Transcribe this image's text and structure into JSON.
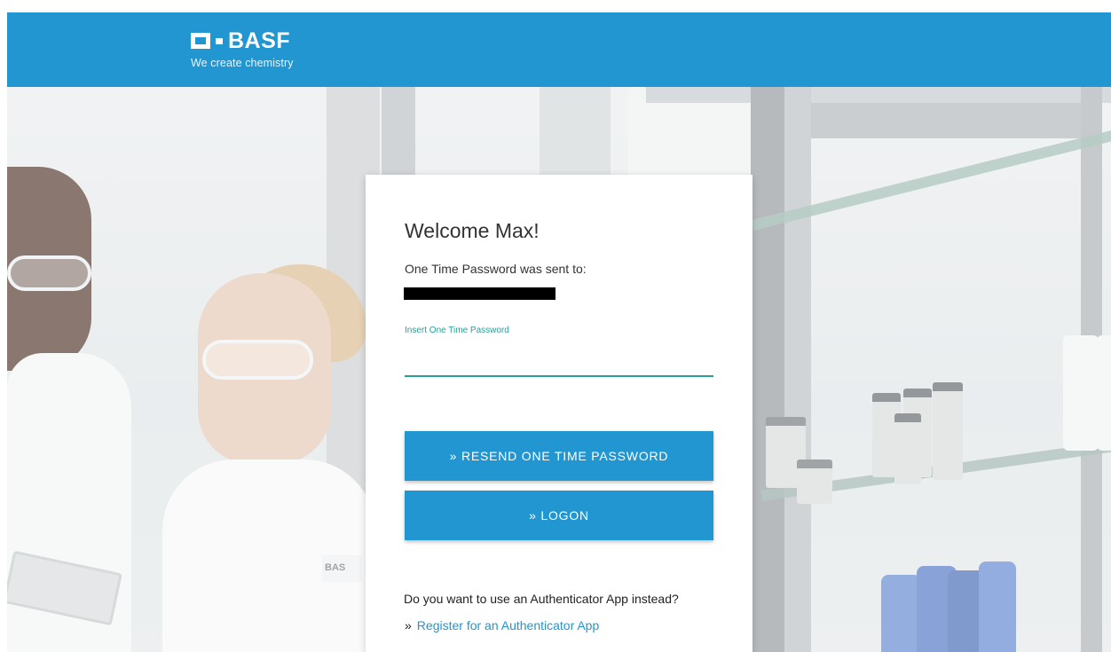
{
  "header": {
    "brand": "BASF",
    "tagline": "We create chemistry",
    "color": "#2196d0"
  },
  "background": {
    "badge_text": "BAS"
  },
  "card": {
    "title": "Welcome Max!",
    "sent_to_label": "One Time Password was sent to:",
    "otp_field_label": "Insert One Time Password",
    "otp_value": "",
    "resend_button": "» RESEND ONE TIME PASSWORD",
    "logon_button": "» LOGON",
    "authenticator_question": "Do you want to use an Authenticator App instead?",
    "authenticator_prefix": "»",
    "authenticator_link": "Register for an Authenticator App"
  },
  "colors": {
    "accent": "#2196d0",
    "field_accent": "#2b9d97",
    "text": "#333333"
  }
}
